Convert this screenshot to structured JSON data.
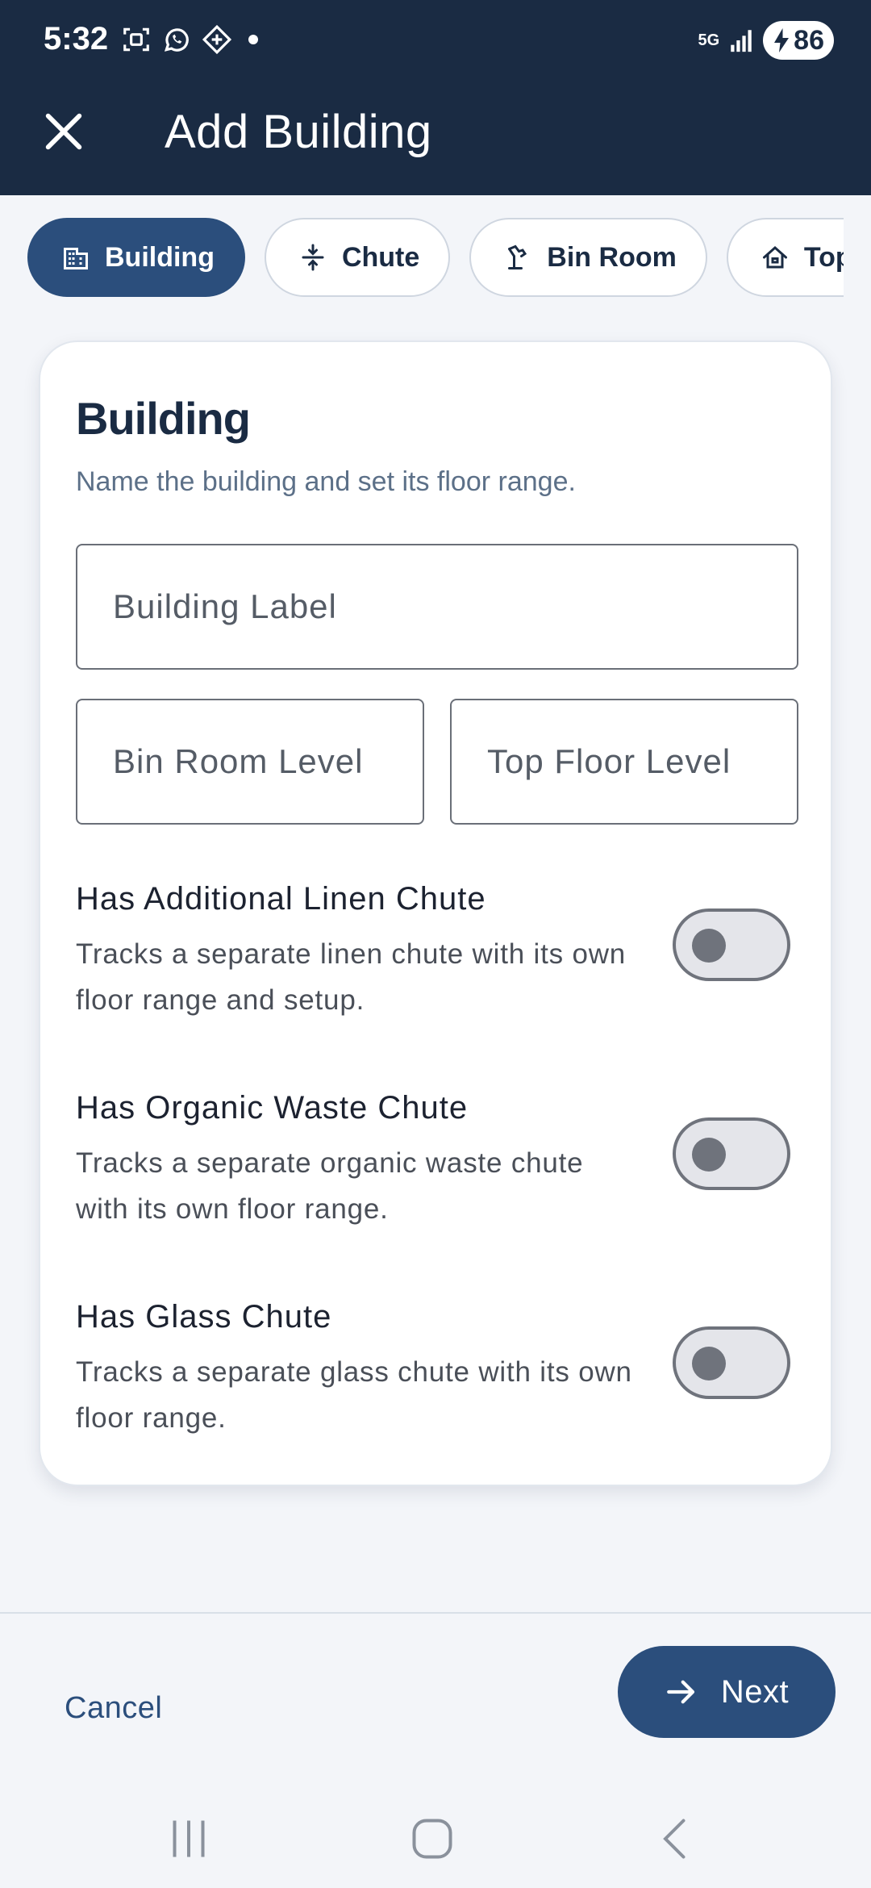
{
  "status_bar": {
    "time": "5:32",
    "network": "5G",
    "battery": "86"
  },
  "app_bar": {
    "title": "Add Building",
    "close_icon": "close-icon"
  },
  "steps": [
    {
      "label": "Building",
      "icon": "building-icon",
      "active": true
    },
    {
      "label": "Chute",
      "icon": "chute-icon",
      "active": false
    },
    {
      "label": "Bin Room",
      "icon": "bin-room-icon",
      "active": false
    },
    {
      "label": "Top F",
      "icon": "top-floor-icon",
      "active": false
    }
  ],
  "card": {
    "title": "Building",
    "subtitle": "Name the building and set its floor range.",
    "fields": {
      "building_label": {
        "placeholder": "Building Label",
        "value": ""
      },
      "bin_room_level": {
        "placeholder": "Bin Room Level",
        "value": ""
      },
      "top_floor_level": {
        "placeholder": "Top Floor Level",
        "value": ""
      }
    },
    "toggles": [
      {
        "title": "Has Additional Linen Chute",
        "description": "Tracks a separate linen chute with its own floor range and setup.",
        "on": false
      },
      {
        "title": "Has Organic Waste Chute",
        "description": "Tracks a separate organic waste chute with its own floor range.",
        "on": false
      },
      {
        "title": "Has Glass Chute",
        "description": "Tracks a separate glass chute with its own floor range.",
        "on": false
      }
    ]
  },
  "actions": {
    "cancel_label": "Cancel",
    "next_label": "Next"
  },
  "colors": {
    "app_bar": "#1a2b43",
    "accent": "#2b4e7c",
    "background": "#f3f5f9"
  }
}
